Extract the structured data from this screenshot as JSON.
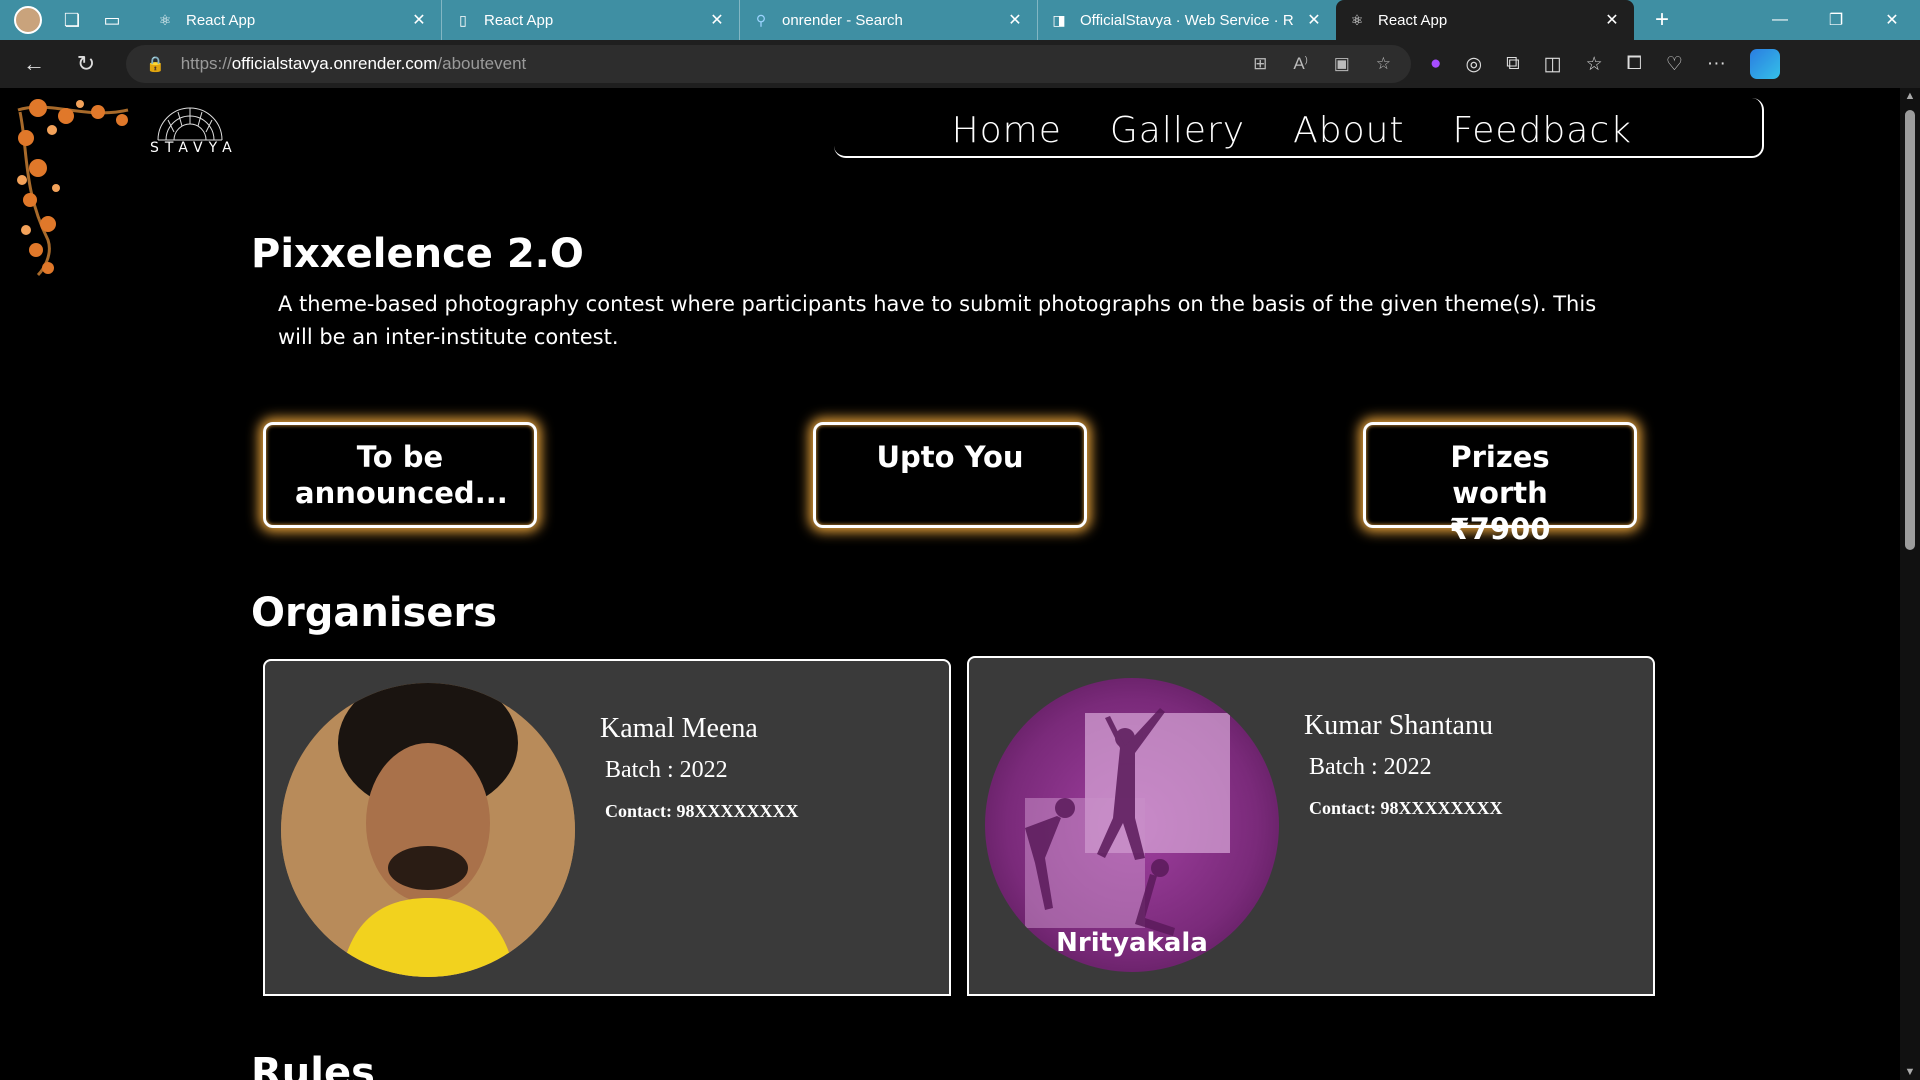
{
  "browser": {
    "tabs": [
      {
        "title": "React App",
        "icon": "react-icon"
      },
      {
        "title": "React App",
        "icon": "page-icon"
      },
      {
        "title": "onrender - Search",
        "icon": "search-icon"
      },
      {
        "title": "OfficialStavya · Web Service · R",
        "icon": "render-icon"
      },
      {
        "title": "React App",
        "icon": "react-icon"
      }
    ],
    "address": {
      "scheme": "https://",
      "host": "officialstavya.onrender.com",
      "path": "/aboutevent"
    }
  },
  "site": {
    "logo_text": "STAVYA",
    "nav": [
      "Home",
      "Gallery",
      "About",
      "Feedback"
    ]
  },
  "event": {
    "title": "Pixxelence 2.O",
    "description": "A theme-based photography contest where participants have to submit photographs on the basis of the given theme(s). This will be an inter-institute contest.",
    "boxes": [
      "To be announced...",
      "Upto You",
      "Prizes worth ₹7900"
    ]
  },
  "organisers": {
    "heading": "Organisers",
    "people": [
      {
        "name": "Kamal Meena",
        "batch": "Batch : 2022",
        "contact": "Contact: 98XXXXXXXX"
      },
      {
        "name": "Kumar Shantanu",
        "batch": "Batch : 2022",
        "contact": "Contact: 98XXXXXXXX",
        "image_label": "Nrityakala"
      }
    ]
  },
  "next_heading": "Rules",
  "colors": {
    "glow": "#e8a23a",
    "card": "#3a3a3a",
    "tabbar": "#3f8fa3"
  }
}
